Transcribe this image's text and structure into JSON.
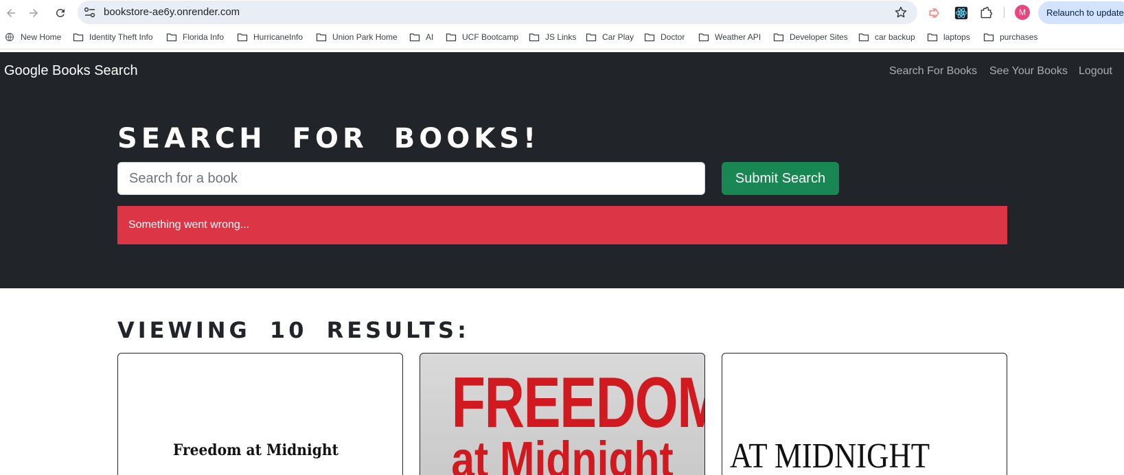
{
  "browser": {
    "url": "bookstore-ae6y.onrender.com",
    "relaunch_label": "Relaunch to update",
    "profile_initial": "M",
    "bookmarks": [
      {
        "label": "New Home",
        "icon": "globe-icon"
      },
      {
        "label": "Identity Theft Info",
        "icon": "folder-icon"
      },
      {
        "label": "Florida Info",
        "icon": "folder-icon"
      },
      {
        "label": "HurricaneInfo",
        "icon": "folder-icon"
      },
      {
        "label": "Union Park Home",
        "icon": "folder-icon"
      },
      {
        "label": "AI",
        "icon": "folder-icon"
      },
      {
        "label": "UCF Bootcamp",
        "icon": "folder-icon"
      },
      {
        "label": "JS Links",
        "icon": "folder-icon"
      },
      {
        "label": "Car Play",
        "icon": "folder-icon"
      },
      {
        "label": "Doctor",
        "icon": "folder-icon"
      },
      {
        "label": "Weather API",
        "icon": "folder-icon"
      },
      {
        "label": "Developer Sites",
        "icon": "folder-icon"
      },
      {
        "label": "car backup",
        "icon": "folder-icon"
      },
      {
        "label": "laptops",
        "icon": "folder-icon"
      },
      {
        "label": "purchases",
        "icon": "folder-icon"
      }
    ]
  },
  "navbar": {
    "brand": "Google Books Search",
    "links": [
      "Search For Books",
      "See Your Books",
      "Logout"
    ]
  },
  "hero": {
    "title": "Search for Books!",
    "search_placeholder": "Search for a book",
    "submit_label": "Submit Search",
    "alert_text": "Something went wrong..."
  },
  "results": {
    "heading": "Viewing 10 results:",
    "covers": [
      {
        "text": "Freedom at Midnight"
      },
      {
        "line1": "FREEDOM",
        "line2": "at Midnight"
      },
      {
        "text": "AT MIDNIGHT"
      }
    ]
  },
  "colors": {
    "navbar_bg": "#212529",
    "submit_bg": "#198754",
    "alert_bg": "#dc3545",
    "cover_red": "#d01a1f"
  }
}
